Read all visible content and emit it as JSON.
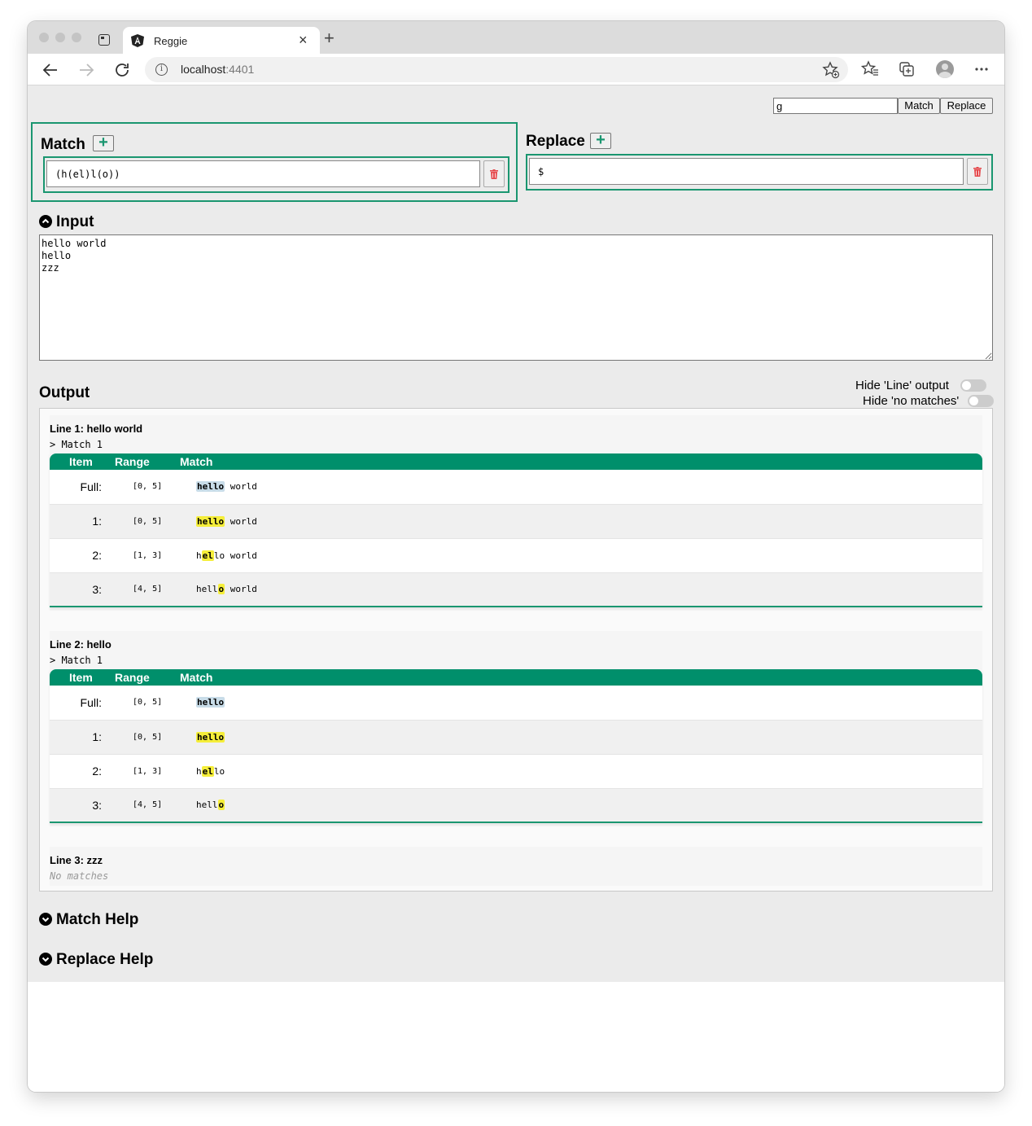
{
  "browser": {
    "tab_title": "Reggie",
    "tab_close": "×",
    "new_tab": "+",
    "url_host": "localhost",
    "url_port": ":4401",
    "info": "i"
  },
  "topbar": {
    "mode_value": "g",
    "match_button": "Match",
    "replace_button": "Replace"
  },
  "match_panel": {
    "title": "Match",
    "add_label": "+",
    "expression": "(h(el)l(o))"
  },
  "replace_panel": {
    "title": "Replace",
    "add_label": "+",
    "expression": "$"
  },
  "input_section": {
    "title": "Input",
    "text": "hello world\nhello\nzzz"
  },
  "output_section": {
    "title": "Output",
    "toggle_line_label": "Hide 'Line' output",
    "toggle_nomatch_label": "Hide 'no matches'",
    "table_headers": [
      "Item",
      "Range",
      "Match"
    ],
    "lines": [
      {
        "header": "Line 1: hello world",
        "match_label": "> Match 1",
        "rows": [
          {
            "item": "Full:",
            "range": "[0, 5]",
            "pre": "",
            "hit": "hello",
            "post": " world",
            "full": true
          },
          {
            "item": "1:",
            "range": "[0, 5]",
            "pre": "",
            "hit": "hello",
            "post": " world",
            "full": false
          },
          {
            "item": "2:",
            "range": "[1, 3]",
            "pre": "h",
            "hit": "el",
            "post": "lo world",
            "full": false
          },
          {
            "item": "3:",
            "range": "[4, 5]",
            "pre": "hell",
            "hit": "o",
            "post": " world",
            "full": false
          }
        ]
      },
      {
        "header": "Line 2: hello",
        "match_label": "> Match 1",
        "rows": [
          {
            "item": "Full:",
            "range": "[0, 5]",
            "pre": "",
            "hit": "hello",
            "post": "",
            "full": true
          },
          {
            "item": "1:",
            "range": "[0, 5]",
            "pre": "",
            "hit": "hello",
            "post": "",
            "full": false
          },
          {
            "item": "2:",
            "range": "[1, 3]",
            "pre": "h",
            "hit": "el",
            "post": "lo",
            "full": false
          },
          {
            "item": "3:",
            "range": "[4, 5]",
            "pre": "hell",
            "hit": "o",
            "post": "",
            "full": false
          }
        ]
      },
      {
        "header": "Line 3: zzz",
        "no_matches": "No matches"
      }
    ]
  },
  "help_sections": {
    "match_help": "Match Help",
    "replace_help": "Replace Help"
  },
  "colors": {
    "accent": "#008f6b",
    "panel_border": "#1a9670",
    "highlight": "#f5ee3a",
    "full_highlight": "#c8dce8"
  }
}
